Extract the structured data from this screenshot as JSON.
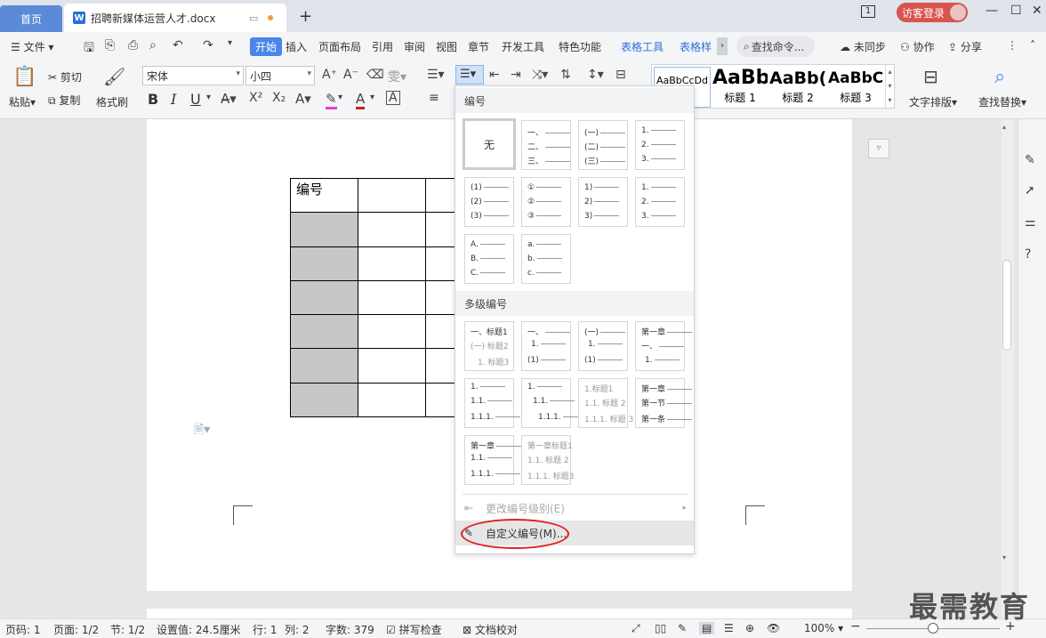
{
  "titlebar": {
    "home_tab": "首页",
    "doc_tab": "招聘新媒体运营人才.docx",
    "doc_icon": "W",
    "new_tab": "+",
    "login": "访客登录",
    "page_badge": "1"
  },
  "menu": {
    "file": "文件",
    "items": [
      "开始",
      "插入",
      "页面布局",
      "引用",
      "审阅",
      "视图",
      "章节",
      "开发工具",
      "特色功能",
      "表格工具",
      "表格样"
    ],
    "search": "查找命令...",
    "unsync": "未同步",
    "collab": "协作",
    "share": "分享"
  },
  "ribbon": {
    "paste": "粘贴",
    "cut": "剪切",
    "copy": "复制",
    "format_painter": "格式刷",
    "font_name": "宋体",
    "font_size": "小四",
    "bold": "B",
    "italic": "I",
    "underline": "U",
    "text_layout": "文字排版",
    "find_replace": "查找替换",
    "styles": [
      {
        "preview": "AaBbCcDd",
        "label": ""
      },
      {
        "preview": "AaBb",
        "label": "标题 1"
      },
      {
        "preview": "AaBb(",
        "label": "标题 2"
      },
      {
        "preview": "AaBbC",
        "label": "标题 3"
      }
    ]
  },
  "document": {
    "header_cell": "编号"
  },
  "dropdown": {
    "section_numbering": "编号",
    "none_option": "无",
    "section_multilevel": "多级编号",
    "change_level": "更改编号级别(E)",
    "custom_numbering": "自定义编号(M)...",
    "numbering_cells": [
      [
        "一、",
        "二、",
        "三、"
      ],
      [
        "(一)",
        "(二)",
        "(三)"
      ],
      [
        "1.",
        "2.",
        "3."
      ],
      [
        "(1)",
        "(2)",
        "(3)"
      ],
      [
        "①",
        "②",
        "③"
      ],
      [
        "1)",
        "2)",
        "3)"
      ],
      [
        "1.",
        "2.",
        "3."
      ],
      [
        "A.",
        "B.",
        "C."
      ],
      [
        "a.",
        "b.",
        "c."
      ]
    ],
    "multilevel_cells": [
      [
        "一、标题1",
        "(一) 标题2",
        "1. 标题3"
      ],
      [
        "一、",
        "1.",
        "(1)"
      ],
      [
        "(一)",
        "1.",
        "(1)"
      ],
      [
        "第一章",
        "一、",
        "1."
      ],
      [
        "1.",
        "1.1.",
        "1.1.1."
      ],
      [
        "1.",
        "1.1.",
        "1.1.1."
      ],
      [
        "1.标题1",
        "1.1. 标题 2",
        "1.1.1. 标题 3"
      ],
      [
        "第一章",
        "第一节",
        "第一条"
      ],
      [
        "第一章",
        "1.1.",
        "1.1.1."
      ],
      [
        "第一章标题1",
        "1.1. 标题 2",
        "1.1.1. 标题3"
      ]
    ]
  },
  "statusbar": {
    "page_num": "页码: 1",
    "pages": "页面: 1/2",
    "section": "节: 1/2",
    "setting": "设置值: 24.5厘米",
    "row": "行: 1",
    "col": "列: 2",
    "words": "字数: 379",
    "spell": "拼写检查",
    "proof": "文档校对",
    "zoom": "100%"
  },
  "watermark": "最需教育"
}
